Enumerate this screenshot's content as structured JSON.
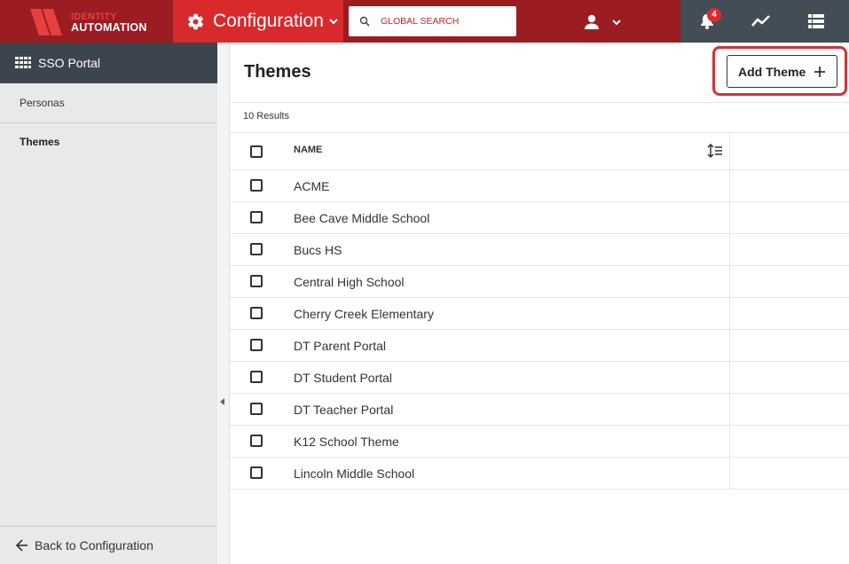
{
  "header": {
    "logo": {
      "line1": "IDENTITY",
      "line2": "AUTOMATION"
    },
    "module_label": "Configuration",
    "search": {
      "placeholder": "GLOBAL SEARCH",
      "value": ""
    },
    "notifications_count": "4",
    "icons": [
      "gear-icon",
      "chevron-down-icon",
      "search-icon",
      "user-icon",
      "bell-icon",
      "trend-icon",
      "apps-icon"
    ],
    "colors": {
      "bar": "#9b1c21",
      "module": "#d82a2d",
      "tools": "#434d56",
      "badge": "#e0282e"
    }
  },
  "sidebar": {
    "title": "SSO Portal",
    "items": [
      {
        "label": "Personas",
        "active": false
      },
      {
        "label": "Themes",
        "active": true
      }
    ],
    "back_label": "Back to Configuration"
  },
  "main": {
    "title": "Themes",
    "add_button": "Add Theme",
    "results": "10 Results",
    "table": {
      "columns": [
        "NAME"
      ],
      "rows": [
        "ACME",
        "Bee Cave Middle School",
        "Bucs HS",
        "Central High School",
        "Cherry Creek Elementary",
        "DT Parent Portal",
        "DT Student Portal",
        "DT Teacher Portal",
        "K12 School Theme",
        "Lincoln Middle School"
      ]
    }
  }
}
